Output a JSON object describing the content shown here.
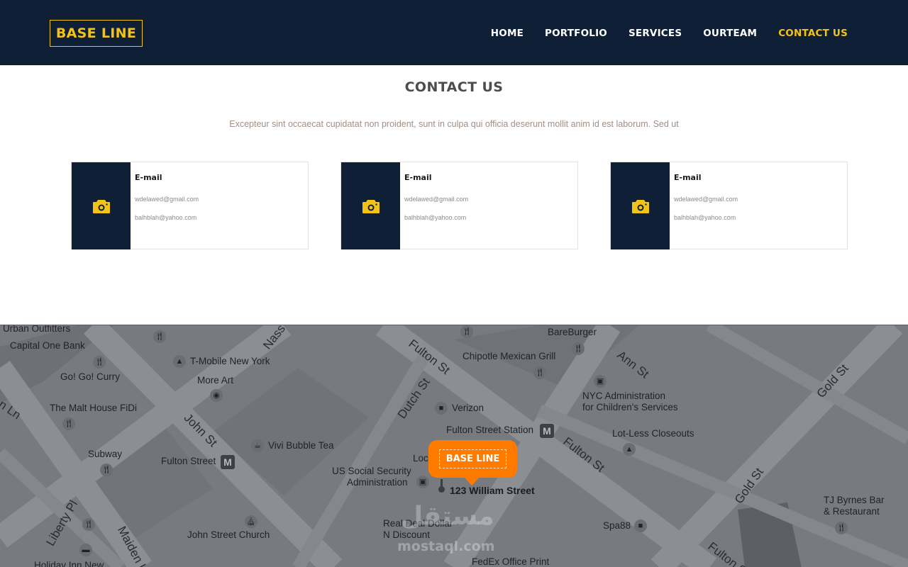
{
  "header": {
    "logo": "BASE LINE",
    "nav": [
      "HOME",
      "PORTFOLIO",
      "SERVICES",
      "OURTEAM",
      "CONTACT US"
    ],
    "active_index": 4
  },
  "contact": {
    "title": "CONTACT US",
    "subtitle": "Excepteur sint occaecat cupidatat non proident, sunt in culpa qui officia deserunt mollit anim id est laborum. Sed ut",
    "cards": [
      {
        "icon": "camera-icon",
        "title": "E-mail",
        "line1": "wdelawed@gmail.com",
        "line2": "balhblah@yahoo.com"
      },
      {
        "icon": "camera-icon",
        "title": "E-mail",
        "line1": "wdelawed@gmail.com",
        "line2": "balhblah@yahoo.com"
      },
      {
        "icon": "camera-icon",
        "title": "E-mail",
        "line1": "wdelawed@gmail.com",
        "line2": "balhblah@yahoo.com"
      }
    ]
  },
  "map": {
    "pin_label": "BASE LINE",
    "address": "123 William Street",
    "places": [
      "Urban Outfitters",
      "Capital One Bank",
      "Go! Go! Curry",
      "The Malt House FiDi",
      "Subway",
      "T-Mobile New York",
      "More Art",
      "Vivi Bubble Tea",
      "Fulton Street",
      "John Street Church",
      "US Social Security",
      "Administration",
      "Verizon",
      "Fulton Street Station",
      "Chipotle Mexican Grill",
      "BareBurger",
      "NYC Administration",
      "for Children's Services",
      "Lot-Less Closeouts",
      "TJ Byrnes Bar",
      "& Restaurant",
      "Spa88",
      "Real Deal Dollar",
      "N Discount",
      "FedEx Office Print",
      "Holiday Inn New",
      "Loc"
    ],
    "streets": [
      "Nass",
      "John St",
      "Dutch St",
      "Fulton St",
      "Ann St",
      "Gold St",
      "Fulton St",
      "Liberty Pl",
      "Maiden L",
      "Gold St",
      "Fulton St",
      "n Ln"
    ],
    "metro_letter": "M",
    "watermark_ar": "مستقل",
    "watermark": "mostaql.com"
  },
  "colors": {
    "navy": "#0f1f35",
    "yellow": "#f3c316",
    "orange": "#ff7b00"
  }
}
